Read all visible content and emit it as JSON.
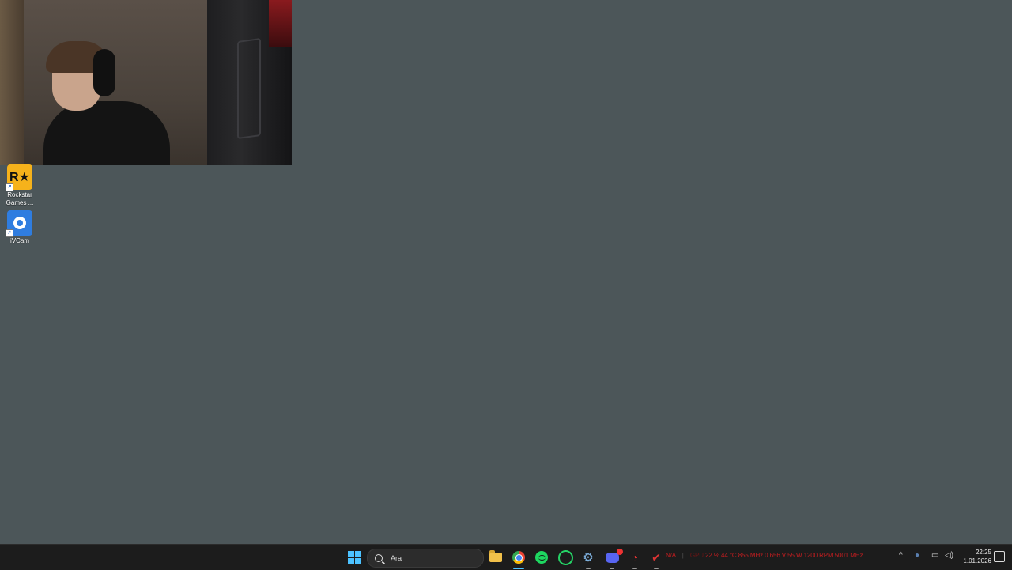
{
  "desktop": {
    "icons": [
      {
        "label": "Rockstar Games ...",
        "glyph": "R★",
        "icon": "rockstar-games-icon"
      },
      {
        "label": "iVCam",
        "icon": "ivcam-icon"
      }
    ],
    "background_color": "#4c5659"
  },
  "taskbar": {
    "search_placeholder": "Ara",
    "apps": [
      "start",
      "search",
      "file-explorer",
      "chrome",
      "spotify",
      "whatsapp",
      "settings-tool",
      "discord",
      "monitor-tool",
      "flag-tool"
    ],
    "hw_stats": {
      "label_na": "N/A",
      "gpu_label": "GPU",
      "load": "22 %",
      "temp": "44 °C",
      "clock": "855 MHz",
      "voltage": "0.656 V",
      "power": "55 W",
      "fan": "1200 RPM",
      "mem_clock": "5001 MHz"
    },
    "tray": {
      "chevron": "^",
      "time": "22:25",
      "date": "1.01.2026"
    }
  }
}
